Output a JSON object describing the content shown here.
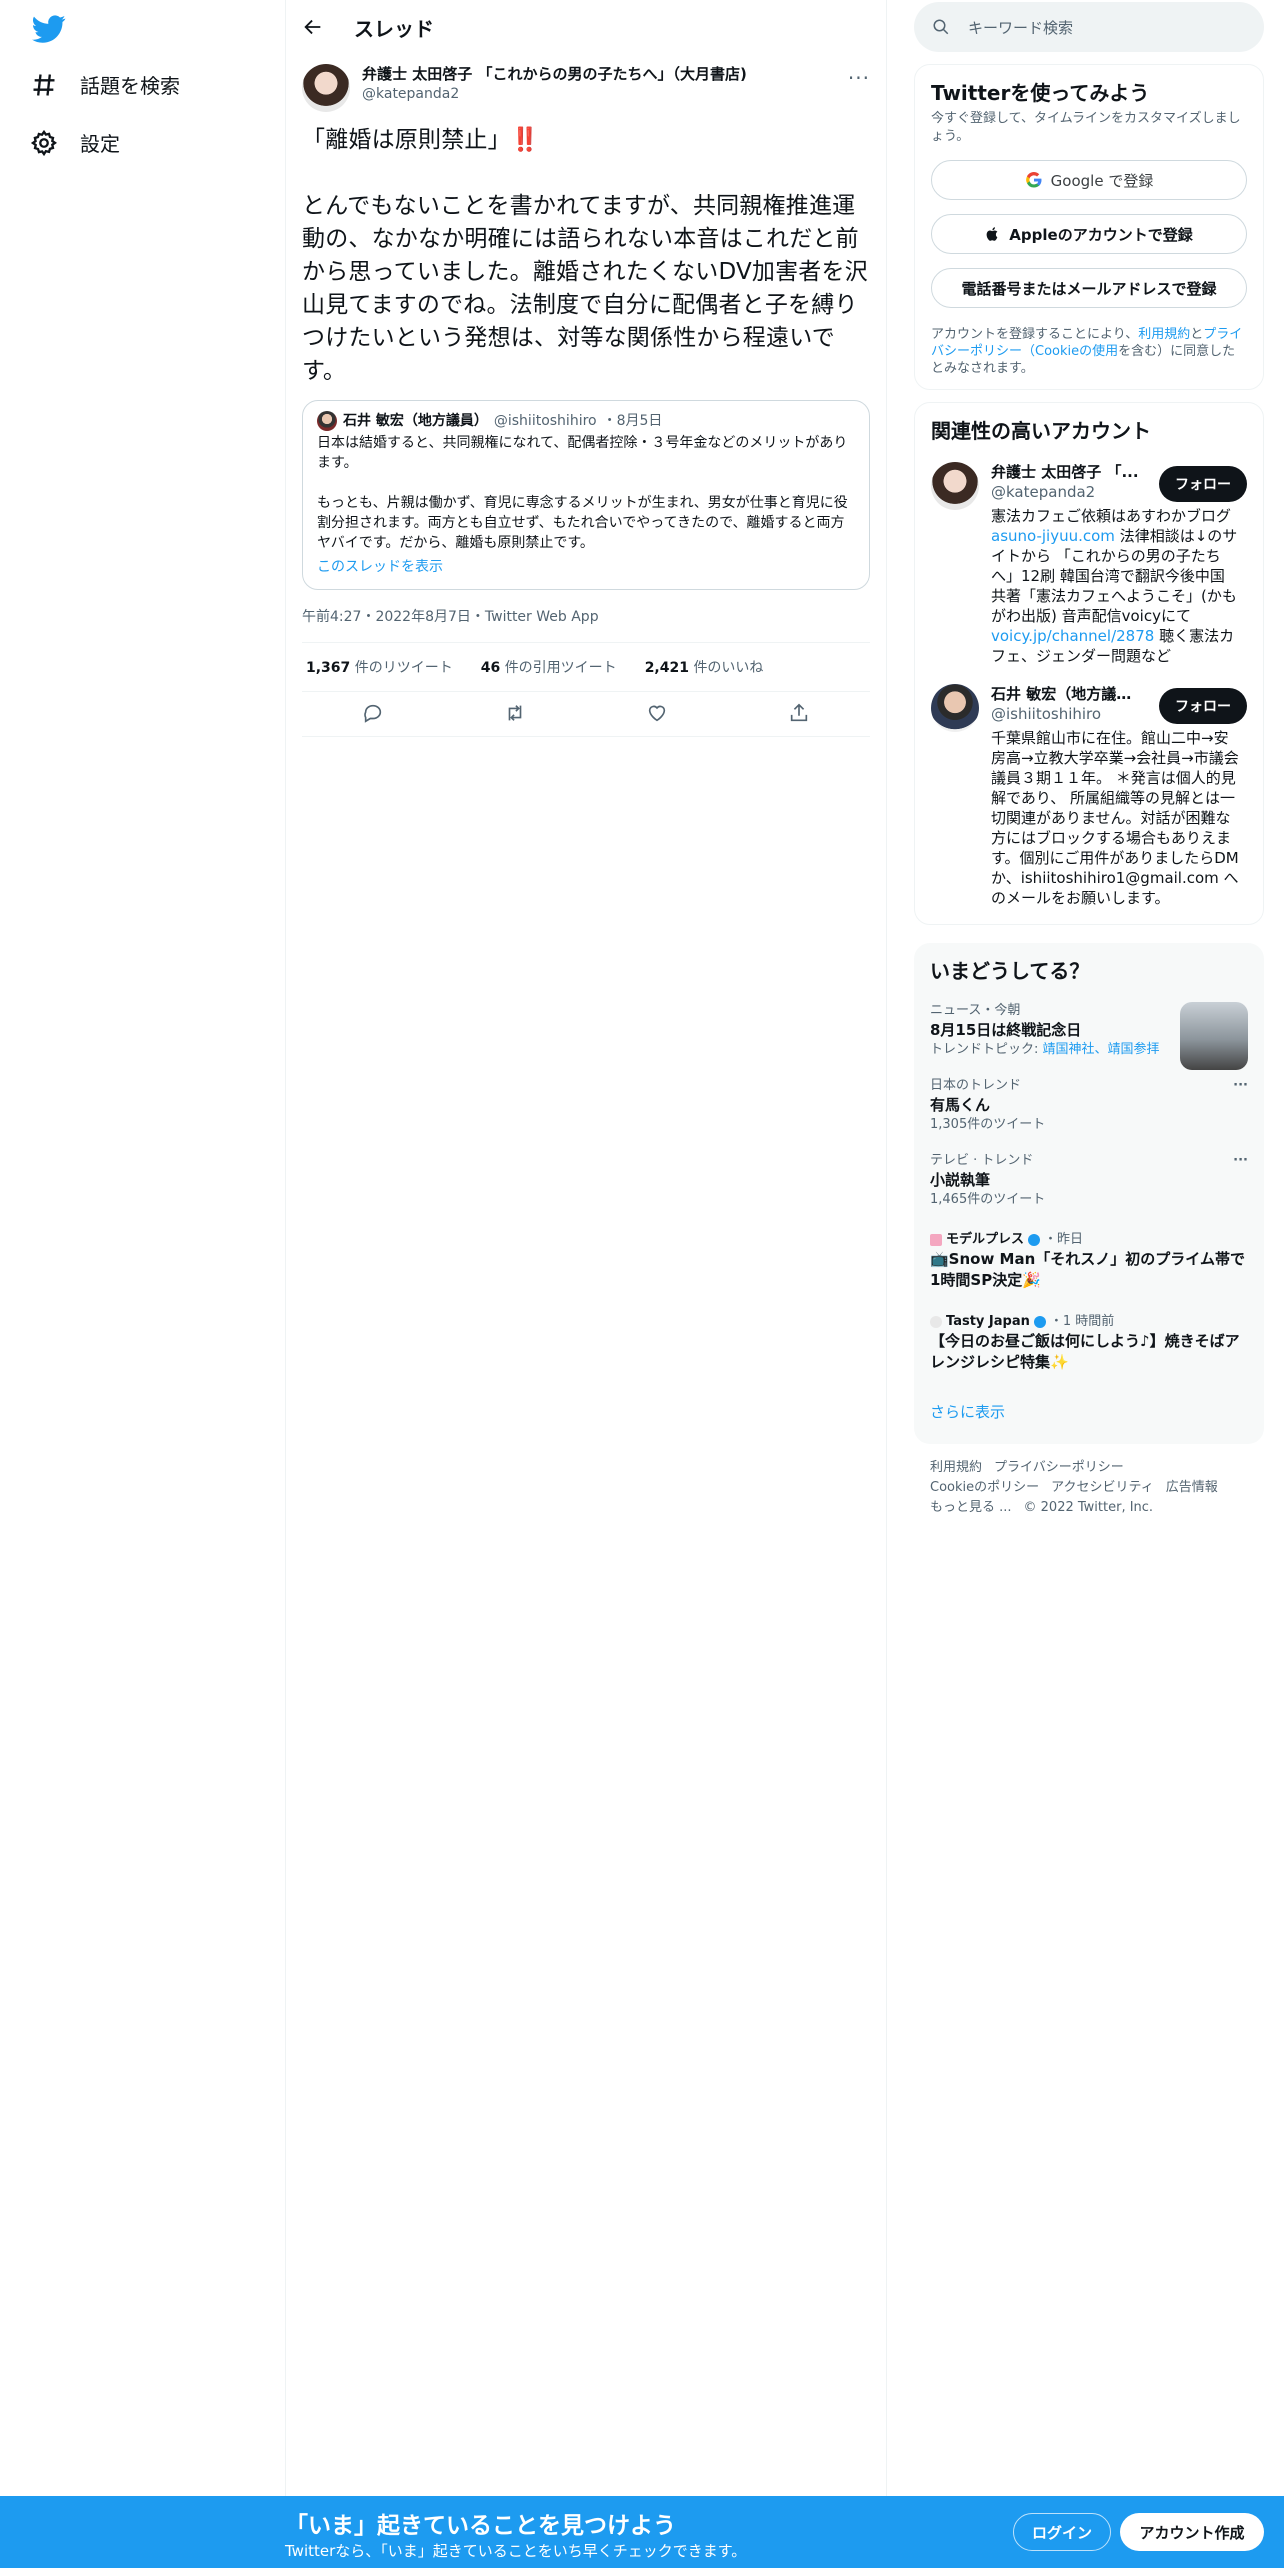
{
  "nav": {
    "explore_label": "話題を検索",
    "settings_label": "設定"
  },
  "header": {
    "title": "スレッド"
  },
  "tweet": {
    "author_name": "弁護士 太田啓子 「これからの男の子たちへ」（大月書店)",
    "author_handle": "@katepanda2",
    "text_line1": "「離婚は原則禁止」",
    "text_bang": "‼️",
    "text_body": "とんでもないことを書かれてますが、共同親権推進運動の、なかなか明確には語られない本音はこれだと前から思っていました。離婚されたくないDV加害者を沢山見てますのでね。法制度で自分に配偶者と子を縛りつけたいという発想は、対等な関係性から程遠いです。",
    "timestamp": "午前4:27・2022年8月7日・Twitter Web App",
    "retweets": "1,367",
    "retweets_label": "件のリツイート",
    "quotes": "46",
    "quotes_label": "件の引用ツイート",
    "likes": "2,421",
    "likes_label": "件のいいね"
  },
  "quote": {
    "name": "石井 敏宏（地方議員）",
    "handle": "@ishiitoshihiro",
    "date": "・8月5日",
    "text": "日本は結婚すると、共同親権になれて、配偶者控除・３号年金などのメリットがあります。\n\nもっとも、片親は働かず、育児に専念するメリットが生まれ、男女が仕事と育児に役割分担されます。両方とも自立せず、もたれ合いでやってきたので、離婚すると両方ヤバイです。だから、離婚も原則禁止です。",
    "show_thread": "このスレッドを表示"
  },
  "search": {
    "placeholder": "キーワード検索"
  },
  "signup_card": {
    "title": "Twitterを使ってみよう",
    "subtitle": "今すぐ登録して、タイムラインをカスタマイズしましょう。",
    "google": "Google で登録",
    "apple": "Appleのアカウントで登録",
    "phone": "電話番号またはメールアドレスで登録",
    "terms_pre": "アカウントを登録することにより、",
    "terms_link1": "利用規約",
    "terms_mid": "と",
    "terms_link2": "プライバシーポリシー（Cookieの使用",
    "terms_post": "を含む）に同意したとみなされます。"
  },
  "related": {
    "title": "関連性の高いアカウント",
    "follow_label": "フォロー",
    "accounts": [
      {
        "name": "弁護士 太田啓子 「...",
        "handle": "@katepanda2",
        "bio_pre": "憲法カフェご依頼はあすわかブログ",
        "bio_link1": "asuno-jiyuu.com",
        "bio_mid": " 法律相談は↓のサイトから 「これからの男の子たちへ」12刷 韓国台湾で翻訳今後中国 共著「憲法カフェへようこそ」(かもがわ出版) 音声配信voicyにて",
        "bio_link2": "voicy.jp/channel/2878",
        "bio_post": " 聴く憲法カフェ、ジェンダー問題など"
      },
      {
        "name": "石井 敏宏（地方議員...",
        "handle": "@ishiitoshihiro",
        "bio": "千葉県館山市に在住。館山二中→安房高→立教大学卒業→会社員→市議会議員３期１１年。 ＊発言は個人的見解であり、 所属組織等の見解とは一切関連がありません。対話が困難な方にはブロックする場合もありえます。個別にご用件がありましたらDMか、ishiitoshihiro1@gmail.com へのメールをお願いします。"
      }
    ]
  },
  "trends": {
    "title": "いまどうしてる？",
    "items": [
      {
        "context": "ニュース・今朝",
        "title": "8月15日は終戦記念日",
        "extra_pre": "トレンドトピック: ",
        "extra_link": "靖国神社、靖国参拝"
      },
      {
        "context": "日本のトレンド",
        "title": "有馬くん",
        "count": "1,305件のツイート"
      },
      {
        "context": "テレビ · トレンド",
        "title": "小説執筆",
        "count": "1,465件のツイート"
      },
      {
        "context": "モデルプレス",
        "time": "・昨日",
        "title": "📺Snow Man「それスノ」初のプライム帯で1時間SP決定🎉"
      },
      {
        "context": "Tasty Japan",
        "time": "・1 時間前",
        "title": "【今日のお昼ご飯は何にしよう♪】焼きそばアレンジレシピ特集✨"
      }
    ],
    "show_more": "さらに表示"
  },
  "footer": {
    "line1": [
      "利用規約",
      "プライバシーポリシー"
    ],
    "line2": [
      "Cookieのポリシー",
      "アクセシビリティ",
      "広告情報"
    ],
    "more": "もっと見る ...",
    "copyright": "© 2022 Twitter, Inc."
  },
  "bottom_bar": {
    "title": "「いま」起きていることを見つけよう",
    "subtitle": "Twitterなら、「いま」起きていることをいち早くチェックできます。",
    "login": "ログイン",
    "signup": "アカウント作成"
  },
  "colors": {
    "accent": "#1d9bf0",
    "text": "#0f1419",
    "muted": "#536471"
  }
}
